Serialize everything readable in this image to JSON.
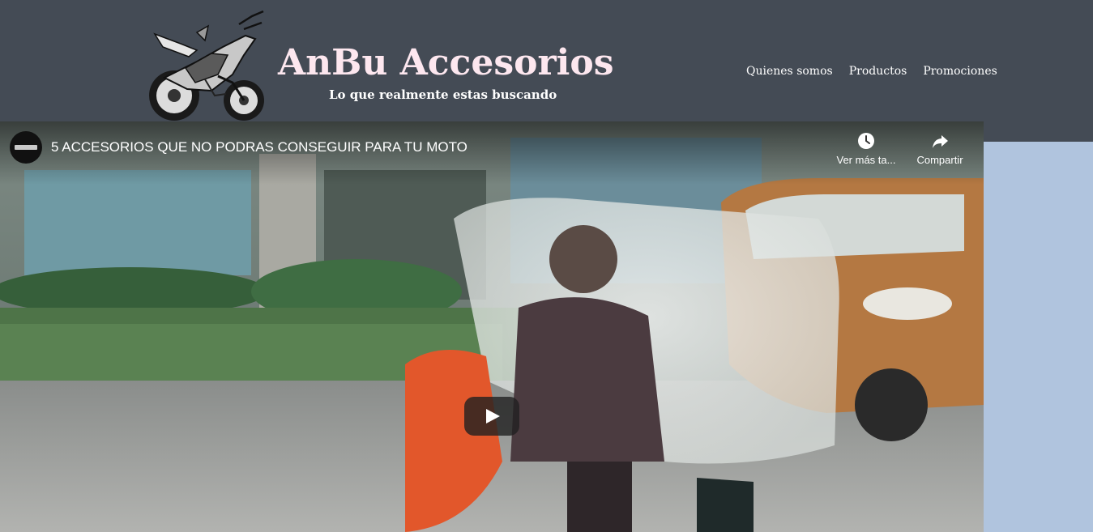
{
  "site": {
    "title": "AnBu Accesorios",
    "tagline": "Lo que realmente estas buscando",
    "logo_icon": "motorcycle-logo"
  },
  "nav": {
    "items": [
      {
        "label": "Quienes somos"
      },
      {
        "label": "Productos"
      },
      {
        "label": "Promociones"
      }
    ]
  },
  "video": {
    "title": "5 ACCESORIOS QUE NO PODRAS CONSEGUIR PARA TU MOTO",
    "watch_later_label": "Ver más ta...",
    "share_label": "Compartir",
    "icons": {
      "watch_later": "clock-icon",
      "share": "share-arrow-icon",
      "play": "play-icon"
    }
  },
  "colors": {
    "header_bg": "#444b55",
    "page_bg": "#b0c4de",
    "title_color": "#fde7ef"
  }
}
